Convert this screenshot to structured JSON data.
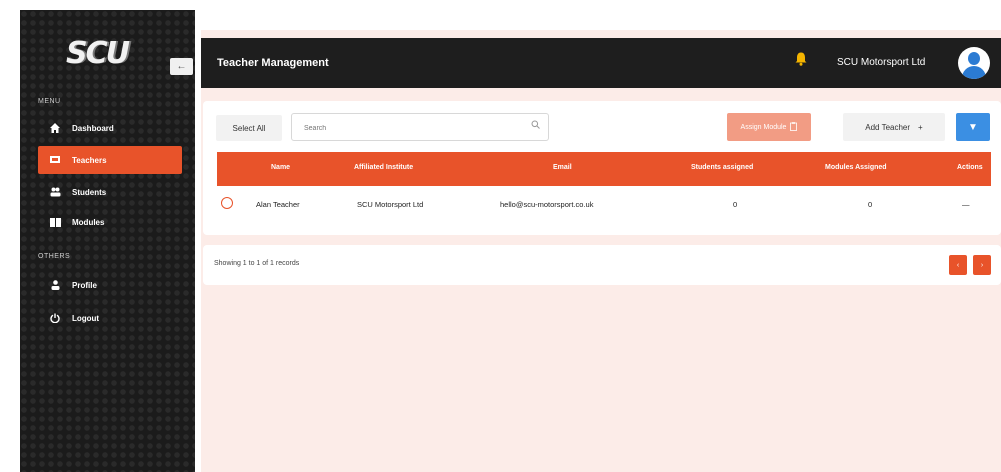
{
  "sidebar": {
    "logo_text": "SCU",
    "collapse_glyph": "←",
    "menu_heading": "MENU",
    "others_heading": "OTHERS",
    "items": [
      {
        "label": "Dashboard",
        "icon": "home-icon"
      },
      {
        "label": "Teachers",
        "icon": "teacher-icon",
        "active": true
      },
      {
        "label": "Students",
        "icon": "users-icon"
      },
      {
        "label": "Modules",
        "icon": "book-icon"
      }
    ],
    "other_items": [
      {
        "label": "Profile",
        "icon": "person-icon"
      },
      {
        "label": "Logout",
        "icon": "power-icon"
      }
    ]
  },
  "header": {
    "title": "Teacher Management",
    "org_name": "SCU Motorsport Ltd"
  },
  "toolbar": {
    "select_all_label": "Select All",
    "search_placeholder": "Search",
    "assign_module_label": "Assign Module",
    "add_teacher_label": "Add Teacher",
    "add_glyph": "+",
    "filter_glyph": "▼"
  },
  "table": {
    "columns": [
      "Name",
      "Affiliated Institute",
      "Email",
      "Students assigned",
      "Modules Assigned",
      "Actions"
    ],
    "rows": [
      {
        "name": "Alan Teacher",
        "institute": "SCU Motorsport Ltd",
        "email": "hello@scu-motorsport.co.uk",
        "students": "0",
        "modules": "0",
        "actions": "—"
      }
    ]
  },
  "footer": {
    "showing_text": "Showing 1 to 1 of 1 records",
    "prev_glyph": "‹",
    "next_glyph": "›"
  },
  "colors": {
    "accent": "#e8532a",
    "sidebar_bg": "#1b1b1b",
    "topbar_bg": "#1e1e1e",
    "page_bg": "#fcece8",
    "filter_blue": "#3b8fe3",
    "assign_disabled": "#f29c84"
  }
}
